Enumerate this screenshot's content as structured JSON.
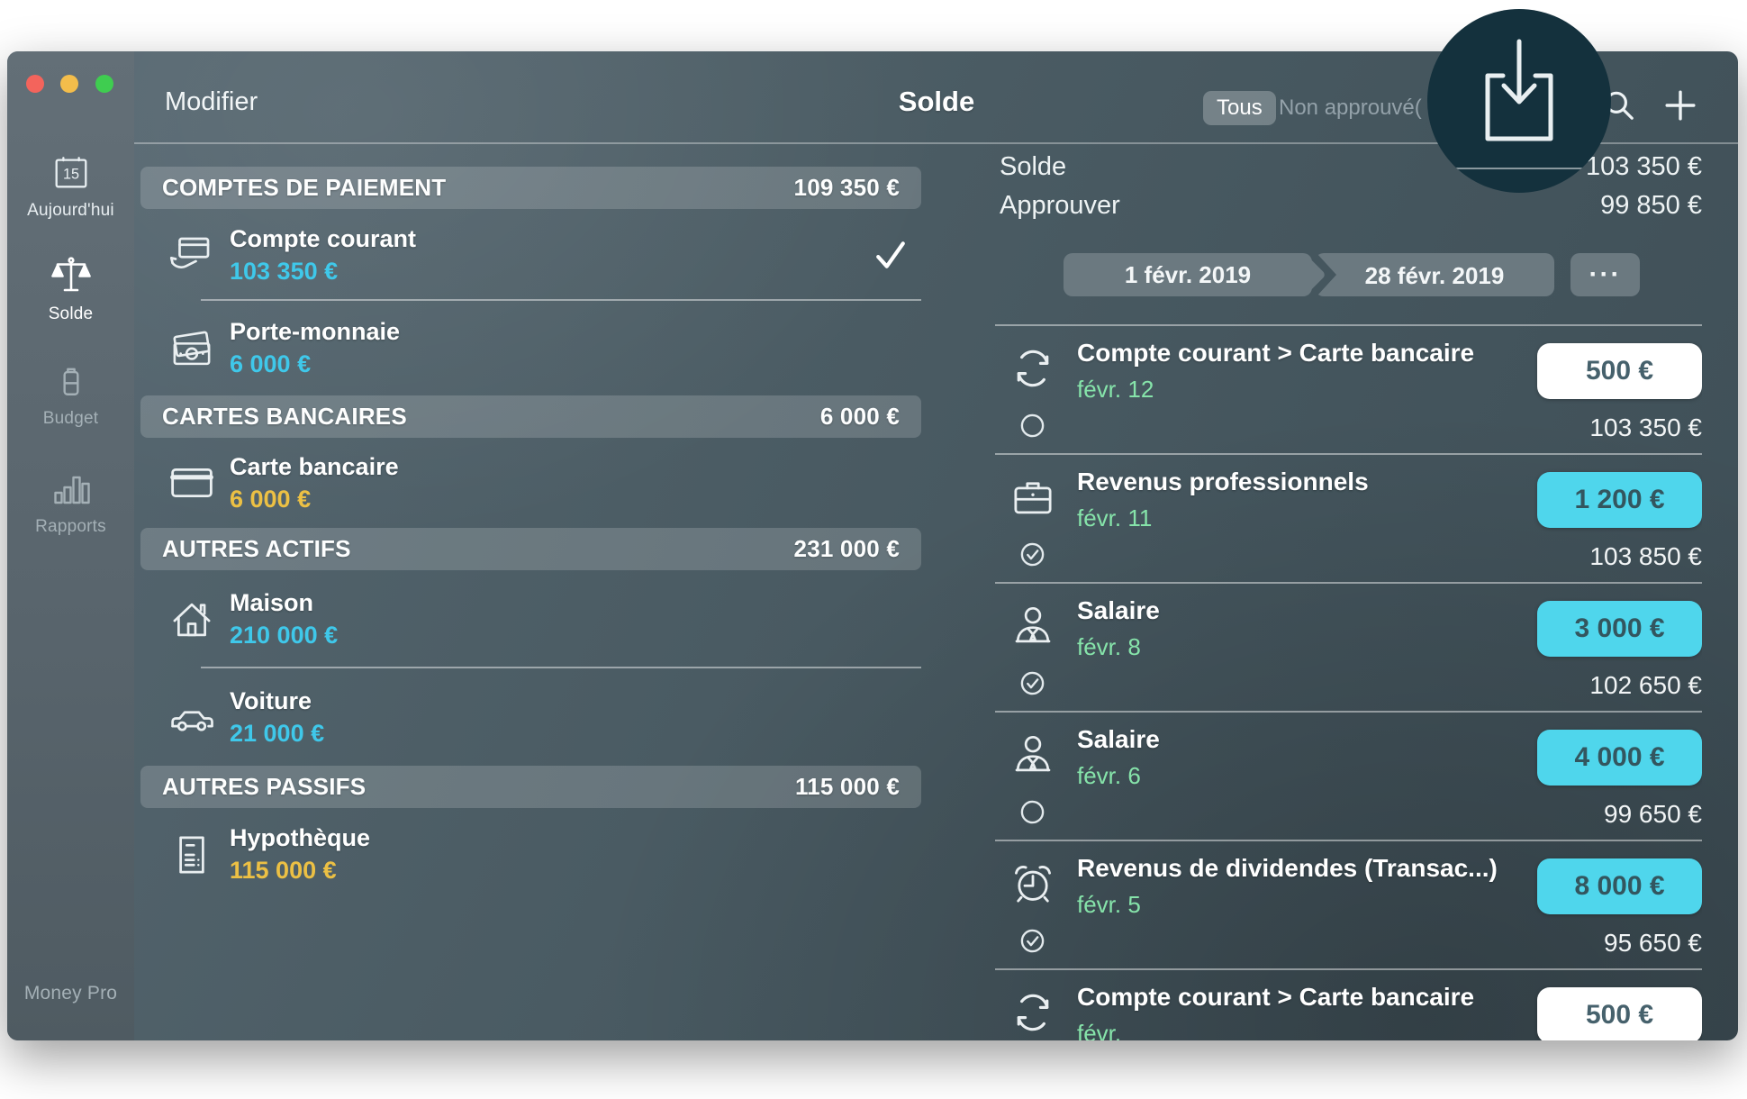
{
  "window": {
    "edit_button": "Modifier",
    "title": "Solde",
    "filter_all": "Tous",
    "filter_unapproved": "Non approuvé(",
    "app_name": "Money Pro"
  },
  "sidebar": {
    "items": [
      {
        "label": "Aujourd'hui",
        "icon": "calendar-icon",
        "calendar_day": "15",
        "state": "bright"
      },
      {
        "label": "Solde",
        "icon": "scales-icon",
        "state": "active"
      },
      {
        "label": "Budget",
        "icon": "battery-icon",
        "state": "dim"
      },
      {
        "label": "Rapports",
        "icon": "bar-chart-icon",
        "state": "dim"
      }
    ],
    "footer": {
      "label": "Money Pro",
      "icon": "people-icon"
    }
  },
  "accounts_panel": {
    "sections": [
      {
        "header": "COMPTES DE PAIEMENT",
        "total": "109 350 €",
        "rows": [
          {
            "name": "Compte courant",
            "amount": "103 350 €",
            "amount_color": "cyan",
            "icon": "hand-card-icon",
            "checked": true
          },
          {
            "name": "Porte-monnaie",
            "amount": "6 000 €",
            "amount_color": "cyan",
            "icon": "cash-icon",
            "checked": false
          }
        ]
      },
      {
        "header": "CARTES BANCAIRES",
        "total": "6 000 €",
        "rows": [
          {
            "name": "Carte bancaire",
            "amount": "6 000 €",
            "amount_color": "yellow",
            "icon": "credit-card-icon",
            "checked": false
          }
        ]
      },
      {
        "header": "AUTRES ACTIFS",
        "total": "231 000 €",
        "rows": [
          {
            "name": "Maison",
            "amount": "210 000 €",
            "amount_color": "cyan",
            "icon": "house-icon",
            "checked": false
          },
          {
            "name": "Voiture",
            "amount": "21 000 €",
            "amount_color": "cyan",
            "icon": "car-icon",
            "checked": false
          }
        ]
      },
      {
        "header": "AUTRES PASSIFS",
        "total": "115 000 €",
        "rows": [
          {
            "name": "Hypothèque",
            "amount": "115 000 €",
            "amount_color": "yellow",
            "icon": "document-icon",
            "checked": false
          }
        ]
      }
    ]
  },
  "transactions_panel": {
    "summary": {
      "balance_label": "Solde",
      "balance_value": "103 350 €",
      "approve_label": "Approuver",
      "approve_value": "99 850 €"
    },
    "date_from": "1 févr. 2019",
    "date_to": "28 févr. 2019",
    "more_button": "···",
    "rows": [
      {
        "title": "Compte courant > Carte bancaire",
        "date": "févr. 12",
        "amount": "500 €",
        "amount_style": "white",
        "balance": "103 350 €",
        "icon": "transfer-icon",
        "status": "unchecked"
      },
      {
        "title": "Revenus professionnels",
        "date": "févr. 11",
        "amount": "1 200 €",
        "amount_style": "cyan",
        "balance": "103 850 €",
        "icon": "briefcase-icon",
        "status": "checked"
      },
      {
        "title": "Salaire",
        "date": "févr. 8",
        "amount": "3 000 €",
        "amount_style": "cyan",
        "balance": "102 650 €",
        "icon": "person-icon",
        "status": "checked"
      },
      {
        "title": "Salaire",
        "date": "févr. 6",
        "amount": "4 000 €",
        "amount_style": "cyan",
        "balance": "99 650 €",
        "icon": "person-icon",
        "status": "unchecked"
      },
      {
        "title": "Revenus de dividendes (Transac...)",
        "date": "févr. 5",
        "amount": "8 000 €",
        "amount_style": "cyan",
        "balance": "95 650 €",
        "icon": "alarm-icon",
        "status": "checked"
      },
      {
        "title": "Compte courant > Carte bancaire",
        "date": "févr.",
        "amount": "500 €",
        "amount_style": "white",
        "balance": "",
        "icon": "transfer-icon",
        "status": "none"
      }
    ]
  },
  "spotlight": {
    "icon": "import-icon"
  },
  "colors": {
    "cyan": "#3fc8ea",
    "yellow": "#ecc044",
    "green": "#86e4aa",
    "pill_cyan": "#4fd6ec",
    "spotlight_bg": "#14313d"
  }
}
